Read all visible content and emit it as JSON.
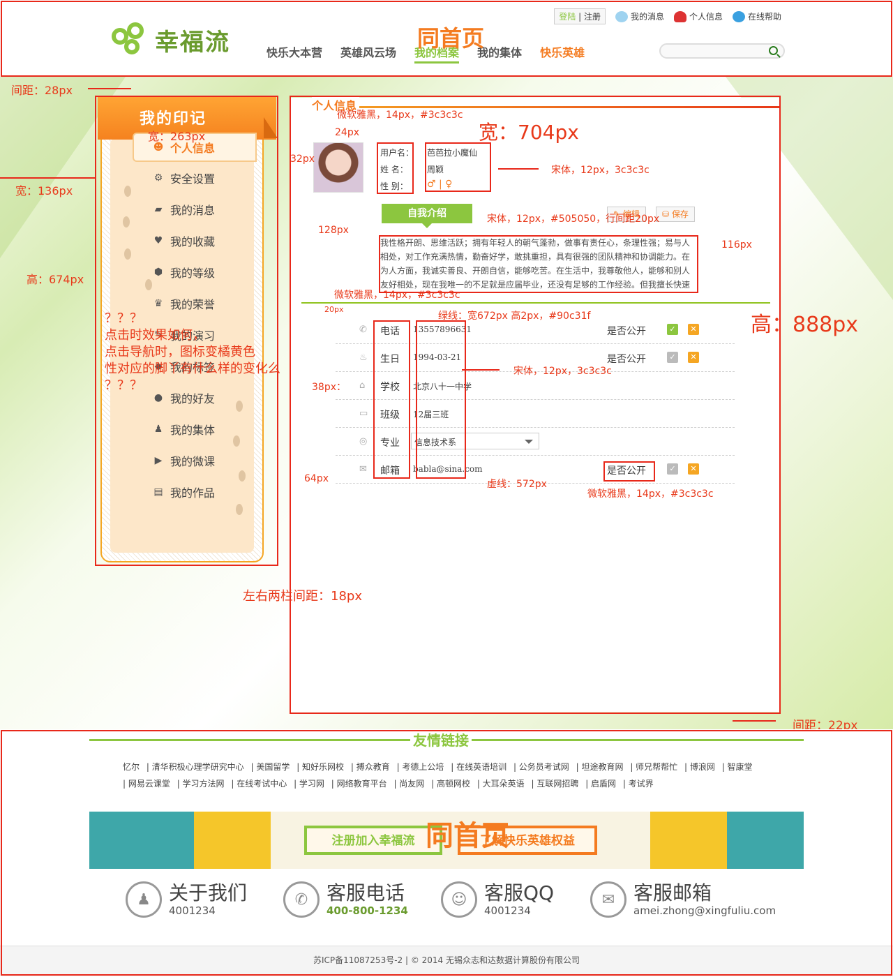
{
  "header": {
    "logo_text": "幸福流",
    "topbar": {
      "login": "登陆",
      "register": "注册",
      "messages": "我的消息",
      "profile": "个人信息",
      "help": "在线帮助"
    },
    "nav": [
      "快乐大本营",
      "英雄风云场",
      "我的档案",
      "我的集体",
      "快乐英雄"
    ],
    "overlay_label": "同首页"
  },
  "left": {
    "title": "我的印记",
    "menu": [
      {
        "label": "个人信息",
        "icon": "smile-icon"
      },
      {
        "label": "安全设置",
        "icon": "gear-icon"
      },
      {
        "label": "我的消息",
        "icon": "chat-icon"
      },
      {
        "label": "我的收藏",
        "icon": "heart-icon"
      },
      {
        "label": "我的等级",
        "icon": "shield-icon"
      },
      {
        "label": "我的荣誉",
        "icon": "trophy-icon"
      },
      {
        "label": "我的演习",
        "icon": "edit-icon"
      },
      {
        "label": "我的标签",
        "icon": "tag-icon"
      },
      {
        "label": "我的好友",
        "icon": "user-icon"
      },
      {
        "label": "我的集体",
        "icon": "group-icon"
      },
      {
        "label": "我的微课",
        "icon": "play-icon"
      },
      {
        "label": "我的作品",
        "icon": "files-icon"
      }
    ]
  },
  "right": {
    "section_title": "个人信息",
    "username_label": "用户名：",
    "username_value": "芭芭拉小魔仙",
    "name_label": "姓  名：",
    "name_value": "周颖",
    "gender_label": "性  别：",
    "gender_value": "♂ | ♀",
    "intro_tag": "自我介绍",
    "edit_label": "编辑",
    "save_label": "保存",
    "intro_text": "我性格开朗、思维活跃；拥有年轻人的朝气蓬勃，做事有责任心，条理性强；易与人相处，对工作充满热情，勤奋好学，敢挑重担，具有很强的团队精神和协调能力。在为人方面，我诚实善良、开朗自信，能够吃苦。在生活中，我尊敬他人，能够和别人友好相处，现在我唯一的不足就是应届毕业，还没有足够的工作经验。但我擅长快速学习新知识，并且对工作",
    "public_label": "是否公开",
    "rows": [
      {
        "label": "电话",
        "value": "13557896631",
        "icon": "phone-icon"
      },
      {
        "label": "生日",
        "value": "1994-03-21",
        "icon": "cake-icon"
      },
      {
        "label": "学校",
        "value": "北京八十一中学",
        "icon": "school-icon"
      },
      {
        "label": "班级",
        "value": "12届三班",
        "icon": "card-icon"
      },
      {
        "label": "专业",
        "value": "信息技术系",
        "icon": "globe-icon"
      },
      {
        "label": "邮箱",
        "value": "babla@sina.com",
        "icon": "mail-icon"
      }
    ]
  },
  "annotations": {
    "gap28": "间距：28px",
    "w263": "宽：263px",
    "w136": "宽：136px",
    "h674": "高：674px",
    "q1": "？？？",
    "q2": "点击时效果如何，",
    "q3": "点击导航时，图标变橘黄色",
    "q4": "性对应的脚丫有什么样的变化么",
    "q5": "？？？",
    "gap18": "左右两栏间距：18px",
    "font1": "微软雅黑，14px，#3c3c3c",
    "w704": "宽：704px",
    "px24": "24px",
    "px32": "32px",
    "font2": "宋体，12px，3c3c3c",
    "font3": "宋体，12px，#505050，行间距20px",
    "px128": "128px",
    "px116": "116px",
    "font4": "微软雅黑，14px，#3c3c3c",
    "greenline": "绿线：宽672px 高2px，#90c31f",
    "px20": "20px",
    "h888": "高：888px",
    "font5": "宋体，12px，3c3c3c",
    "px38": "38px：",
    "px64": "64px",
    "dash": "虚线：572px",
    "font6": "微软雅黑，14px，#3c3c3c",
    "gap22": "间距：22px"
  },
  "footer": {
    "links_title": "友情链接",
    "links_row1": [
      "忆尔",
      "清华积极心理学研究中心",
      "美国留学",
      "知好乐网校",
      "搏众教育",
      "考德上公培",
      "在线英语培训",
      "公务员考试网",
      "坦途教育网",
      "师兄帮帮忙",
      "博浪网",
      "智康堂"
    ],
    "links_row2": [
      "网易云课堂",
      "学习方法网",
      "在线考试中心",
      "学习网",
      "网络教育平台",
      "尚友网",
      "高顿网校",
      "大耳朵英语",
      "互联网招聘",
      "启盾网",
      "考试界"
    ],
    "banner_btn1": "注册加入幸福流",
    "banner_btn2": "了解快乐英雄权益",
    "overlay_label": "同首页",
    "contacts": [
      {
        "title": "关于我们",
        "sub": "4001234",
        "icon": "people-icon"
      },
      {
        "title": "客服电话",
        "sub": "400-800-1234",
        "icon": "phone-icon"
      },
      {
        "title": "客服QQ",
        "sub": "4001234",
        "icon": "qq-icon"
      },
      {
        "title": "客服邮箱",
        "sub": "amei.zhong@xingfuliu.com",
        "icon": "mail-icon"
      }
    ],
    "copyright": "苏ICP备11087253号-2 | © 2014   无锡众志和达数据计算股份有限公司"
  }
}
